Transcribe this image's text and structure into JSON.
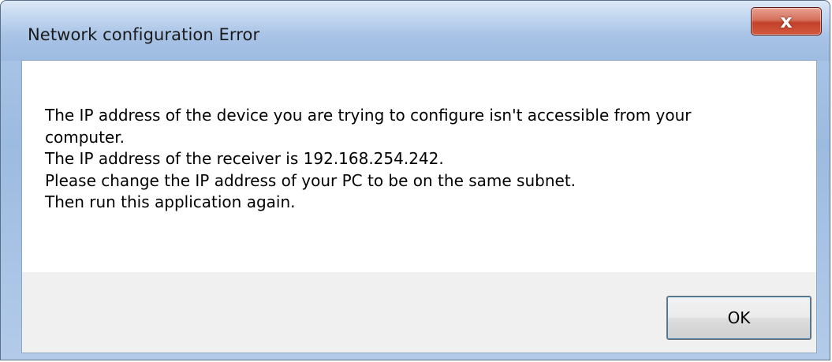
{
  "window": {
    "title": "Network configuration Error",
    "close_symbol": "x",
    "close_icon": "close-icon"
  },
  "message": {
    "lines": [
      "The IP address of the device you are trying to configure isn't accessible from your",
      "computer.",
      "The IP address of the receiver is 192.168.254.242.",
      "Please change the IP address of your PC to be on the same subnet.",
      "Then run this application again."
    ]
  },
  "buttons": {
    "ok_label": "OK"
  },
  "colors": {
    "titlebar": "#a7c2e5",
    "close_button": "#c3412a",
    "button_area": "#f0f0f0",
    "focus_ring": "#3c7fb1"
  }
}
